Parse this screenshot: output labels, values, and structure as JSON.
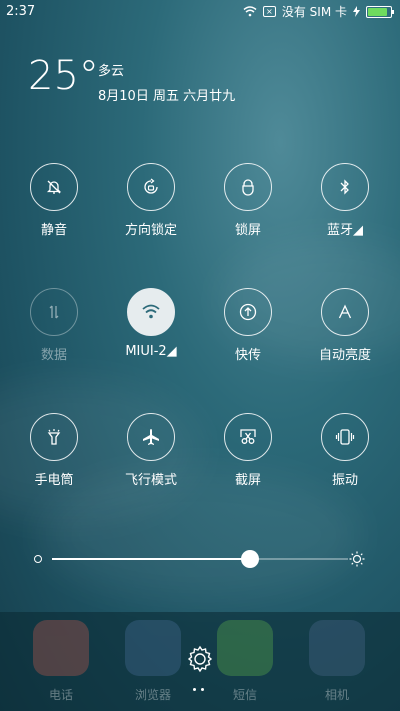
{
  "status_bar": {
    "time": "2:37",
    "sim_status": "没有 SIM 卡",
    "battery_color": "#6fdc5f"
  },
  "weather": {
    "temperature": "25°",
    "condition": "多云",
    "date": "8月10日 周五 六月廿九"
  },
  "toggles": [
    {
      "label": "静音",
      "icon": "bell-off-icon",
      "enabled": true
    },
    {
      "label": "方向锁定",
      "icon": "rotation-lock-icon",
      "enabled": true
    },
    {
      "label": "锁屏",
      "icon": "lock-icon",
      "enabled": true
    },
    {
      "label": "蓝牙◢",
      "icon": "bluetooth-icon",
      "enabled": true
    },
    {
      "label": "数据",
      "icon": "data-arrows-icon",
      "enabled": false
    },
    {
      "label": "MIUI-2◢",
      "icon": "wifi-icon",
      "enabled": true,
      "active": true
    },
    {
      "label": "快传",
      "icon": "quick-share-icon",
      "enabled": true
    },
    {
      "label": "自动亮度",
      "icon": "auto-brightness-icon",
      "enabled": true
    },
    {
      "label": "手电筒",
      "icon": "flashlight-icon",
      "enabled": true
    },
    {
      "label": "飞行模式",
      "icon": "airplane-icon",
      "enabled": true
    },
    {
      "label": "截屏",
      "icon": "screenshot-icon",
      "enabled": true
    },
    {
      "label": "振动",
      "icon": "vibrate-icon",
      "enabled": true
    }
  ],
  "brightness": {
    "level": 0.67
  },
  "dock": {
    "apps": [
      {
        "label": "电话",
        "color": "#c55a4e"
      },
      {
        "label": "浏览器",
        "color": "#4a6f9a"
      },
      {
        "label": "短信",
        "color": "#5fb34a"
      },
      {
        "label": "相机",
        "color": "#4d6a8f"
      }
    ]
  }
}
